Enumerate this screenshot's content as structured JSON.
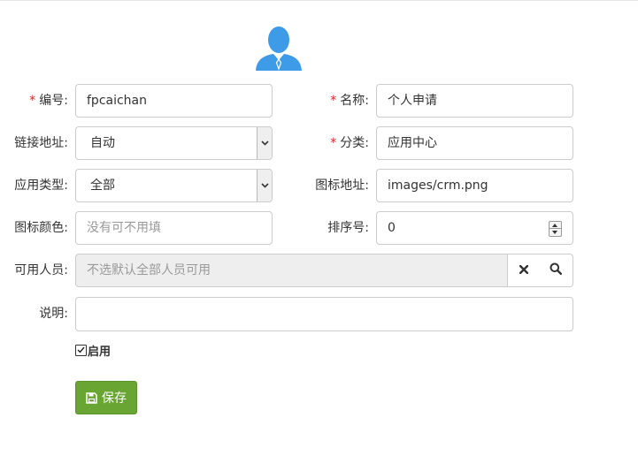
{
  "form": {
    "code": {
      "label": "编号:",
      "required": true,
      "value": "fpcaichan"
    },
    "name": {
      "label": "名称:",
      "required": true,
      "value": "个人申请"
    },
    "link": {
      "label": "链接地址:",
      "value": "自动"
    },
    "category": {
      "label": "分类:",
      "required": true,
      "value": "应用中心"
    },
    "app_type": {
      "label": "应用类型:",
      "value": "全部"
    },
    "icon_path": {
      "label": "图标地址:",
      "value": "images/crm.png"
    },
    "icon_color": {
      "label": "图标颜色:",
      "placeholder": "没有可不用填",
      "value": ""
    },
    "sort_order": {
      "label": "排序号:",
      "value": "0"
    },
    "users": {
      "label": "可用人员:",
      "placeholder": "不选默认全部人员可用",
      "value": ""
    },
    "description": {
      "label": "说明:",
      "value": ""
    },
    "enabled": {
      "label": "启用",
      "checked": true
    },
    "save_label": "保存",
    "required_mark": "*"
  },
  "icons": {
    "avatar": "user-avatar-icon",
    "clear": "close-icon",
    "search": "search-icon",
    "save": "floppy-disk-icon",
    "select_arrow": "chevron-down-icon"
  },
  "colors": {
    "avatar": "#3d9be8",
    "required": "#e0222a",
    "save_button": "#69a533",
    "disabled_field": "#eeeeee"
  }
}
